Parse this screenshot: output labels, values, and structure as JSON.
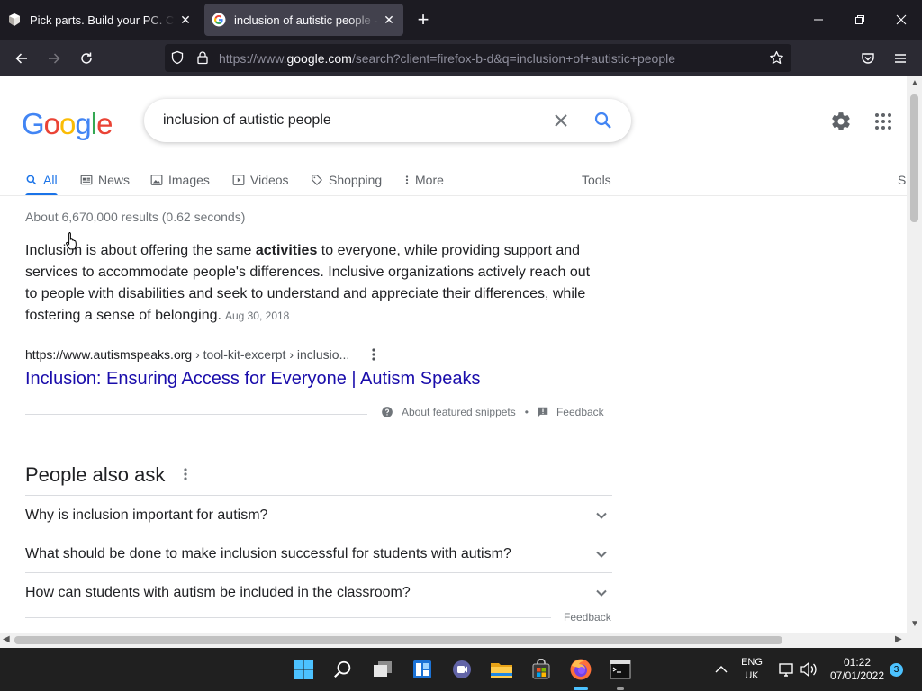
{
  "browser": {
    "tabs": [
      {
        "title": "Pick parts. Build your PC. Compare and share.",
        "active": false
      },
      {
        "title": "inclusion of autistic people - Google Search",
        "active": true
      }
    ],
    "url": {
      "scheme": "https://www.",
      "host": "google.com",
      "rest": "/search?client=firefox-b-d&q=inclusion+of+autistic+people"
    }
  },
  "search": {
    "logo": "Google",
    "query": "inclusion of autistic people",
    "tabs": [
      {
        "label": "All",
        "icon": "search-icon"
      },
      {
        "label": "News",
        "icon": "news-icon"
      },
      {
        "label": "Images",
        "icon": "image-icon"
      },
      {
        "label": "Videos",
        "icon": "video-icon"
      },
      {
        "label": "Shopping",
        "icon": "tag-icon"
      },
      {
        "label": "More",
        "icon": "more-icon"
      }
    ],
    "tools": "Tools",
    "safe_search_partial": "S",
    "stats": "About 6,670,000 results (0.62 seconds)"
  },
  "featured_snippet": {
    "text_before": "Inclusion is about offering the same ",
    "bold": "activities",
    "text_after": " to everyone, while providing support and services to accommodate people's differences. Inclusive organizations actively reach out to people with disabilities and seek to understand and appreciate their differences, while fostering a sense of belonging.",
    "date": "Aug 30, 2018",
    "cite_domain": "https://www.autismspeaks.org",
    "cite_path": " › tool-kit-excerpt › inclusio...",
    "result_title": "Inclusion: Ensuring Access for Everyone | Autism Speaks",
    "about_label": "About featured snippets",
    "bullet": "•",
    "feedback": "Feedback"
  },
  "people_also_ask": {
    "heading": "People also ask",
    "questions": [
      "Why is inclusion important for autism?",
      "What should be done to make inclusion successful for students with autism?",
      "How can students with autism be included in the classroom?"
    ],
    "feedback": "Feedback"
  },
  "taskbar": {
    "lang_line1": "ENG",
    "lang_line2": "UK",
    "time": "01:22",
    "date": "07/01/2022",
    "notifications": "3"
  },
  "colors": {
    "accent": "#1a73e8",
    "link": "#1a0dab",
    "chrome_bg": "#1c1b22",
    "taskbar_bg": "#202020"
  }
}
